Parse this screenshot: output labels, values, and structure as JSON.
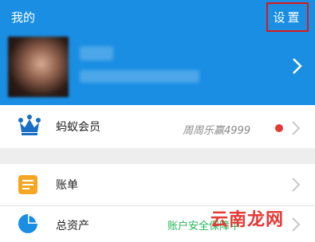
{
  "header": {
    "title": "我的",
    "settings_label": "设置",
    "highlight_color": "#d71a1a",
    "background_color": "#1a8ee3"
  },
  "profile": {
    "avatar_icon": "avatar-photo",
    "chevron_icon": "chevron-right-icon"
  },
  "menu": {
    "member": {
      "icon": "crown-icon",
      "label": "蚂蚁会员",
      "status": "周周乐赢4999"
    },
    "bill": {
      "icon": "bill-icon",
      "label": "账单"
    },
    "assets": {
      "icon": "pie-chart-icon",
      "label": "总资产",
      "status": "账户安全保障中"
    }
  },
  "watermark": "云南龙网"
}
